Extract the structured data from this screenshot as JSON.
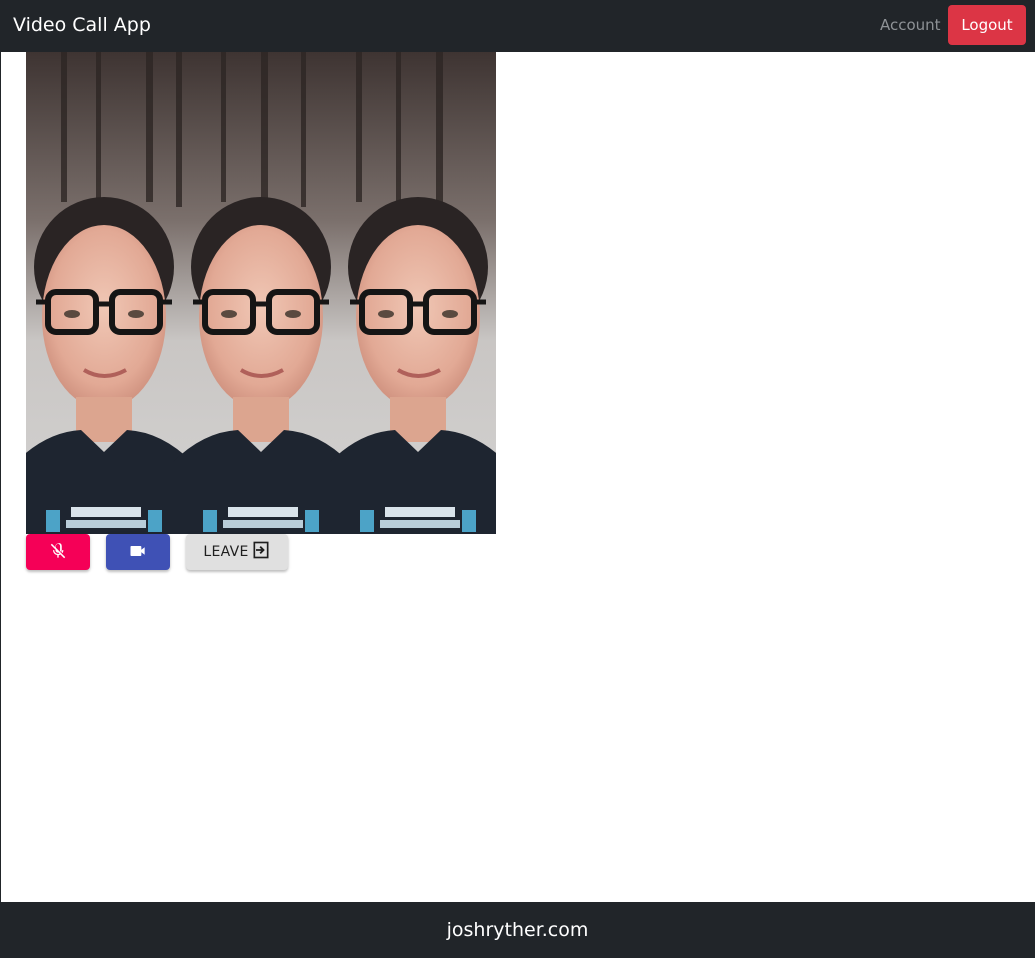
{
  "navbar": {
    "brand": "Video Call App",
    "account_label": "Account",
    "logout_label": "Logout"
  },
  "video": {
    "description_icon": "participant-video"
  },
  "controls": {
    "mic_icon": "mic-off-icon",
    "camera_icon": "videocam-icon",
    "leave_label": "LEAVE",
    "leave_icon": "exit-icon"
  },
  "footer": {
    "text": "joshryther.com"
  },
  "colors": {
    "navbar_bg": "#212529",
    "logout_bg": "#dc3545",
    "mic_bg": "#f50057",
    "camera_bg": "#3f51b5",
    "leave_bg": "#e0e0e0"
  }
}
